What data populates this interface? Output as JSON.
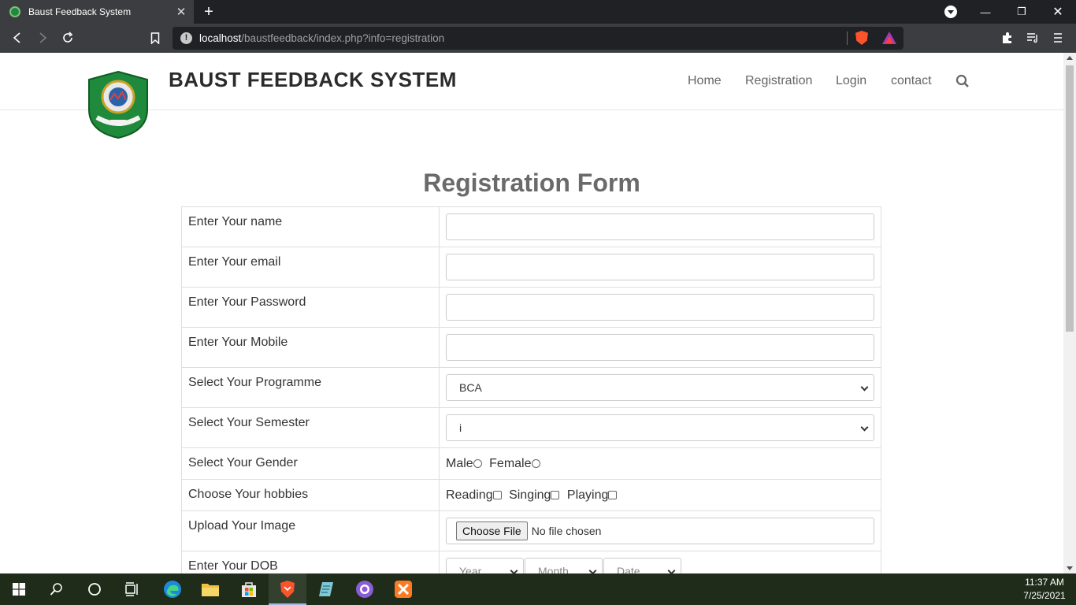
{
  "browser": {
    "tab_title": "Baust Feedback System",
    "url_host": "localhost",
    "url_path": "/baustfeedback/index.php?info=registration"
  },
  "site": {
    "title": "BAUST FEEDBACK SYSTEM",
    "nav": {
      "home": "Home",
      "registration": "Registration",
      "login": "Login",
      "contact": "contact"
    }
  },
  "form": {
    "title": "Registration Form",
    "name_label": "Enter Your name",
    "name_value": "",
    "email_label": "Enter Your email",
    "email_value": "",
    "password_label": "Enter Your Password",
    "password_value": "",
    "mobile_label": "Enter Your Mobile",
    "mobile_value": "",
    "programme_label": "Select Your Programme",
    "programme_value": "BCA",
    "semester_label": "Select Your Semester",
    "semester_value": "i",
    "gender_label": "Select Your Gender",
    "gender_male": "Male",
    "gender_female": "Female",
    "hobbies_label": "Choose Your hobbies",
    "hobby_reading": "Reading",
    "hobby_singing": "Singing",
    "hobby_playing": "Playing",
    "image_label": "Upload Your Image",
    "choose_file": "Choose File",
    "no_file": "No file chosen",
    "dob_label": "Enter Your DOB",
    "dob_year": "Year",
    "dob_month": "Month",
    "dob_date": "Date"
  },
  "taskbar": {
    "time": "11:37 AM",
    "date": "7/25/2021"
  },
  "colors": {
    "logo_green": "#1f8a3b",
    "brave_orange": "#fb542b",
    "taskbar_bg": "#1f2c19"
  }
}
